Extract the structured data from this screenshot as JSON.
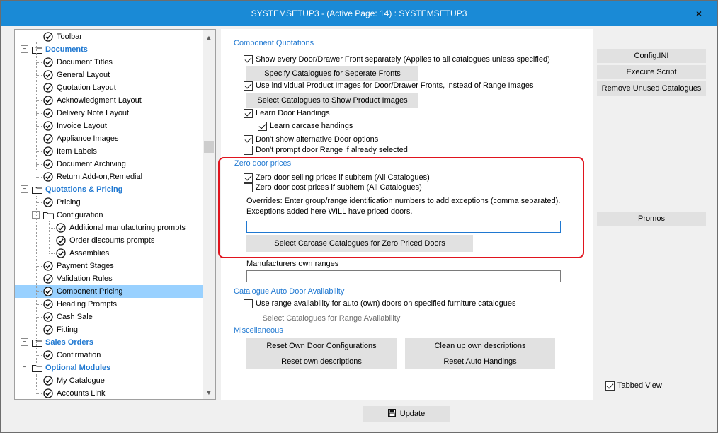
{
  "window": {
    "title": "SYSTEMSETUP3 - (Active Page: 14) : SYSTEMSETUP3",
    "close_glyph": "×"
  },
  "tree": {
    "items": [
      {
        "label": "Toolbar",
        "level": 1,
        "kind": "leaf"
      },
      {
        "label": "Documents",
        "level": 0,
        "kind": "section"
      },
      {
        "label": "Document Titles",
        "level": 1,
        "kind": "leaf"
      },
      {
        "label": "General Layout",
        "level": 1,
        "kind": "leaf"
      },
      {
        "label": "Quotation Layout",
        "level": 1,
        "kind": "leaf"
      },
      {
        "label": "Acknowledgment Layout",
        "level": 1,
        "kind": "leaf"
      },
      {
        "label": "Delivery Note Layout",
        "level": 1,
        "kind": "leaf"
      },
      {
        "label": "Invoice Layout",
        "level": 1,
        "kind": "leaf"
      },
      {
        "label": "Appliance Images",
        "level": 1,
        "kind": "leaf"
      },
      {
        "label": "Item Labels",
        "level": 1,
        "kind": "leaf"
      },
      {
        "label": "Document Archiving",
        "level": 1,
        "kind": "leaf"
      },
      {
        "label": "Return,Add-on,Remedial",
        "level": 1,
        "kind": "leaf"
      },
      {
        "label": "Quotations & Pricing",
        "level": 0,
        "kind": "section"
      },
      {
        "label": "Pricing",
        "level": 1,
        "kind": "leaf"
      },
      {
        "label": "Configuration",
        "level": 1,
        "kind": "folder"
      },
      {
        "label": "Additional manufacturing prompts",
        "level": 2,
        "kind": "leaf"
      },
      {
        "label": "Order discounts prompts",
        "level": 2,
        "kind": "leaf"
      },
      {
        "label": "Assemblies",
        "level": 2,
        "kind": "leaf"
      },
      {
        "label": "Payment Stages",
        "level": 1,
        "kind": "leaf"
      },
      {
        "label": "Validation Rules",
        "level": 1,
        "kind": "leaf"
      },
      {
        "label": "Component Pricing",
        "level": 1,
        "kind": "leaf",
        "selected": true
      },
      {
        "label": "Heading Prompts",
        "level": 1,
        "kind": "leaf"
      },
      {
        "label": "Cash Sale",
        "level": 1,
        "kind": "leaf"
      },
      {
        "label": "Fitting",
        "level": 1,
        "kind": "leaf"
      },
      {
        "label": "Sales Orders",
        "level": 0,
        "kind": "section"
      },
      {
        "label": "Confirmation",
        "level": 1,
        "kind": "leaf"
      },
      {
        "label": "Optional Modules",
        "level": 0,
        "kind": "section"
      },
      {
        "label": "My Catalogue",
        "level": 1,
        "kind": "leaf"
      },
      {
        "label": "Accounts Link",
        "level": 1,
        "kind": "leaf"
      }
    ]
  },
  "component_quotations": {
    "title": "Component Quotations",
    "show_every_front": {
      "label": "Show every Door/Drawer Front separately (Applies to all catalogues unless specified)",
      "checked": true
    },
    "specify_catalogues_button": "Specify Catalogues for Seperate Fronts",
    "use_individual_images": {
      "label": "Use individual Product Images for Door/Drawer Fronts, instead of Range Images",
      "checked": true
    },
    "select_catalogues_images_button": "Select Catalogues to Show Product Images",
    "learn_door_handings": {
      "label": "Learn Door Handings",
      "checked": true
    },
    "learn_carcase_handings": {
      "label": "Learn carcase handings",
      "checked": true
    },
    "dont_show_alt_door": {
      "label": "Don't show alternative Door options",
      "checked": true
    },
    "dont_prompt_door_range": {
      "label": "Don't prompt door Range if already selected",
      "checked": false
    }
  },
  "zero_door_prices": {
    "title": "Zero door prices",
    "zero_selling": {
      "label": "Zero door selling prices if subitem (All Catalogues)",
      "checked": true
    },
    "zero_cost": {
      "label": "Zero door cost prices if subitem (All Catalogues)",
      "checked": false
    },
    "overrides_line1": "Overrides: Enter group/range identification numbers to add exceptions (comma separated).",
    "overrides_line2": "Exceptions added here WILL have priced doors.",
    "overrides_value": "",
    "select_carcase_button": "Select Carcase Catalogues for Zero Priced Doors"
  },
  "manufacturers_own_ranges": {
    "label": "Manufacturers own ranges",
    "value": ""
  },
  "catalogue_auto_door": {
    "title": "Catalogue Auto Door Availability",
    "use_range_availability": {
      "label": "Use range availability for auto (own) doors on specified furniture catalogues",
      "checked": false
    },
    "select_range_button": "Select Catalogues for Range Availability"
  },
  "miscellaneous": {
    "title": "Miscellaneous",
    "reset_own_door": "Reset Own Door Configurations",
    "reset_own_desc": "Reset own descriptions",
    "clean_up_desc": "Clean up own descriptions",
    "reset_auto_handings": "Reset Auto Handings"
  },
  "right_panel": {
    "config_ini": "Config.INI",
    "execute_script": "Execute Script",
    "remove_unused": "Remove Unused Catalogues",
    "promos": "Promos",
    "tabbed_view": {
      "label": "Tabbed View",
      "checked": true
    }
  },
  "footer": {
    "update_label": "Update"
  }
}
